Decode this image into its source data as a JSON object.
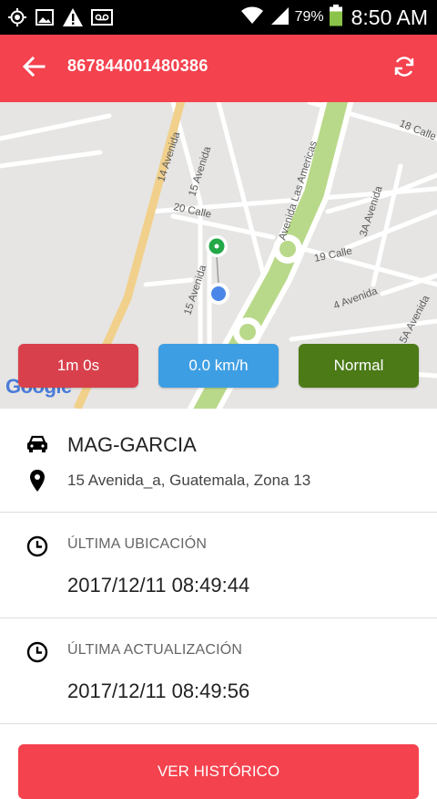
{
  "status_bar": {
    "battery_percent": "79%",
    "time": "8:50 AM",
    "icons": [
      "gps-icon",
      "image-icon",
      "warning-icon",
      "voicemail-icon",
      "wifi-icon",
      "signal-icon",
      "battery-icon"
    ]
  },
  "app_bar": {
    "title": "867844001480386",
    "back_icon": "arrow-back-icon",
    "refresh_icon": "refresh-icon",
    "background": "#f4424e"
  },
  "map": {
    "streets": [
      "18 Calle",
      "14 Avenida",
      "15 Avenida",
      "20 Calle",
      "Avenida Las Americas",
      "3A Avenida",
      "19 Calle",
      "15 Avenida",
      "4 Avenida",
      "5A Avenida"
    ],
    "attribution": "Google",
    "pills": {
      "elapsed": "1m 0s",
      "speed": "0.0 km/h",
      "status": "Normal"
    }
  },
  "vehicle": {
    "name": "MAG-GARCIA",
    "address": "15 Avenida_a, Guatemala, Zona 13"
  },
  "last_location": {
    "label": "ÚLTIMA UBICACIÓN",
    "value": "2017/12/11 08:49:44"
  },
  "last_update": {
    "label": "ÚLTIMA ACTUALIZACIÓN",
    "value": "2017/12/11 08:49:56"
  },
  "actions": {
    "history_label": "VER HISTÓRICO"
  }
}
